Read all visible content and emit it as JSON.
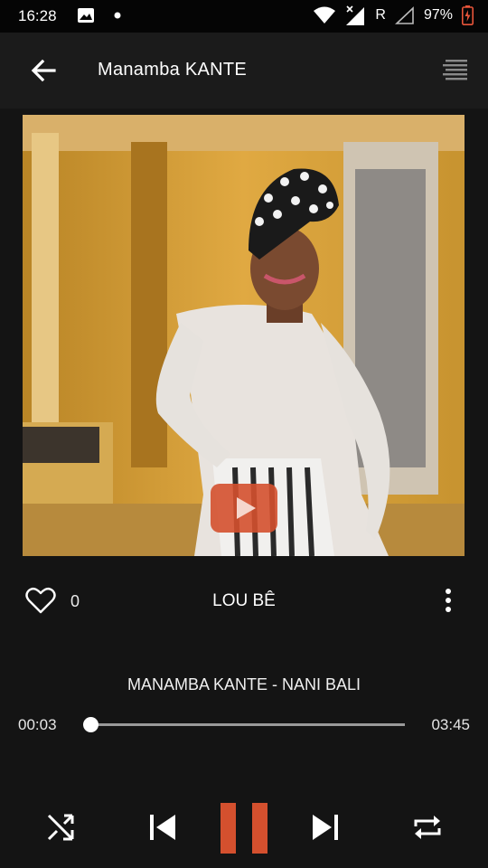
{
  "status_bar": {
    "time": "16:28",
    "network_label": "R",
    "battery": "97%"
  },
  "header": {
    "title": "Manamba KANTE"
  },
  "song": {
    "likes": "0",
    "title": "LOU BÊ",
    "track_name": "MANAMBA KANTE - NANI BALI"
  },
  "player": {
    "current_time": "00:03",
    "total_time": "03:45",
    "progress_fraction": 0.013,
    "is_playing": true
  },
  "colors": {
    "accent": "#d4502e",
    "background": "#141414"
  },
  "icons": {
    "back": "arrow-left-icon",
    "playlist": "playlist-icon",
    "like": "heart-icon",
    "more": "more-vertical-icon",
    "shuffle": "shuffle-icon",
    "previous": "skip-previous-icon",
    "pause": "pause-icon",
    "next": "skip-next-icon",
    "repeat": "repeat-icon",
    "video_play": "video-play-icon"
  }
}
